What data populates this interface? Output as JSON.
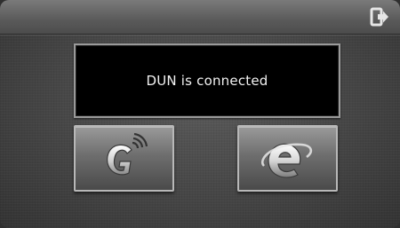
{
  "status": {
    "message": "DUN is connected"
  },
  "toolbar": {
    "exit_icon": "exit-icon"
  },
  "tiles": [
    {
      "icon": "g-connection-icon"
    },
    {
      "icon": "browser-e-icon"
    }
  ]
}
